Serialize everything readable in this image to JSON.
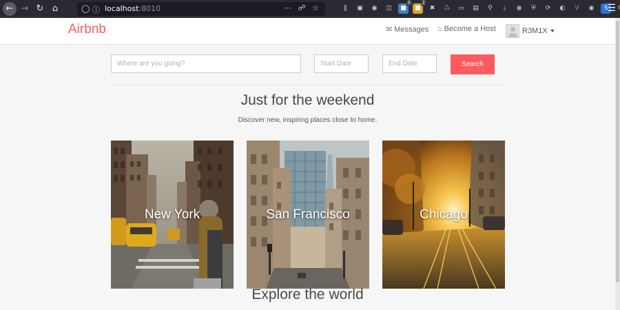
{
  "browser": {
    "url_host": "localhost",
    "url_port": ":8010",
    "ext_badge_1": "0",
    "ext_badge_2": "2"
  },
  "navbar": {
    "brand": "Airbnb",
    "messages_label": "Messages",
    "host_label": "Become a Host",
    "username": "R3M1X"
  },
  "search": {
    "where_placeholder": "Where are you going?",
    "start_placeholder": "Start Date",
    "end_placeholder": "End Date",
    "button_label": "Search"
  },
  "weekend": {
    "title": "Just for the weekend",
    "subtitle": "Discover new, inspiring places close to home."
  },
  "cities": [
    {
      "name": "New York"
    },
    {
      "name": "San Francisco"
    },
    {
      "name": "Chicago"
    }
  ],
  "explore": {
    "title": "Explore the world"
  },
  "colors": {
    "brand": "#ff5a5f",
    "browser_chrome": "#2b2a33"
  }
}
